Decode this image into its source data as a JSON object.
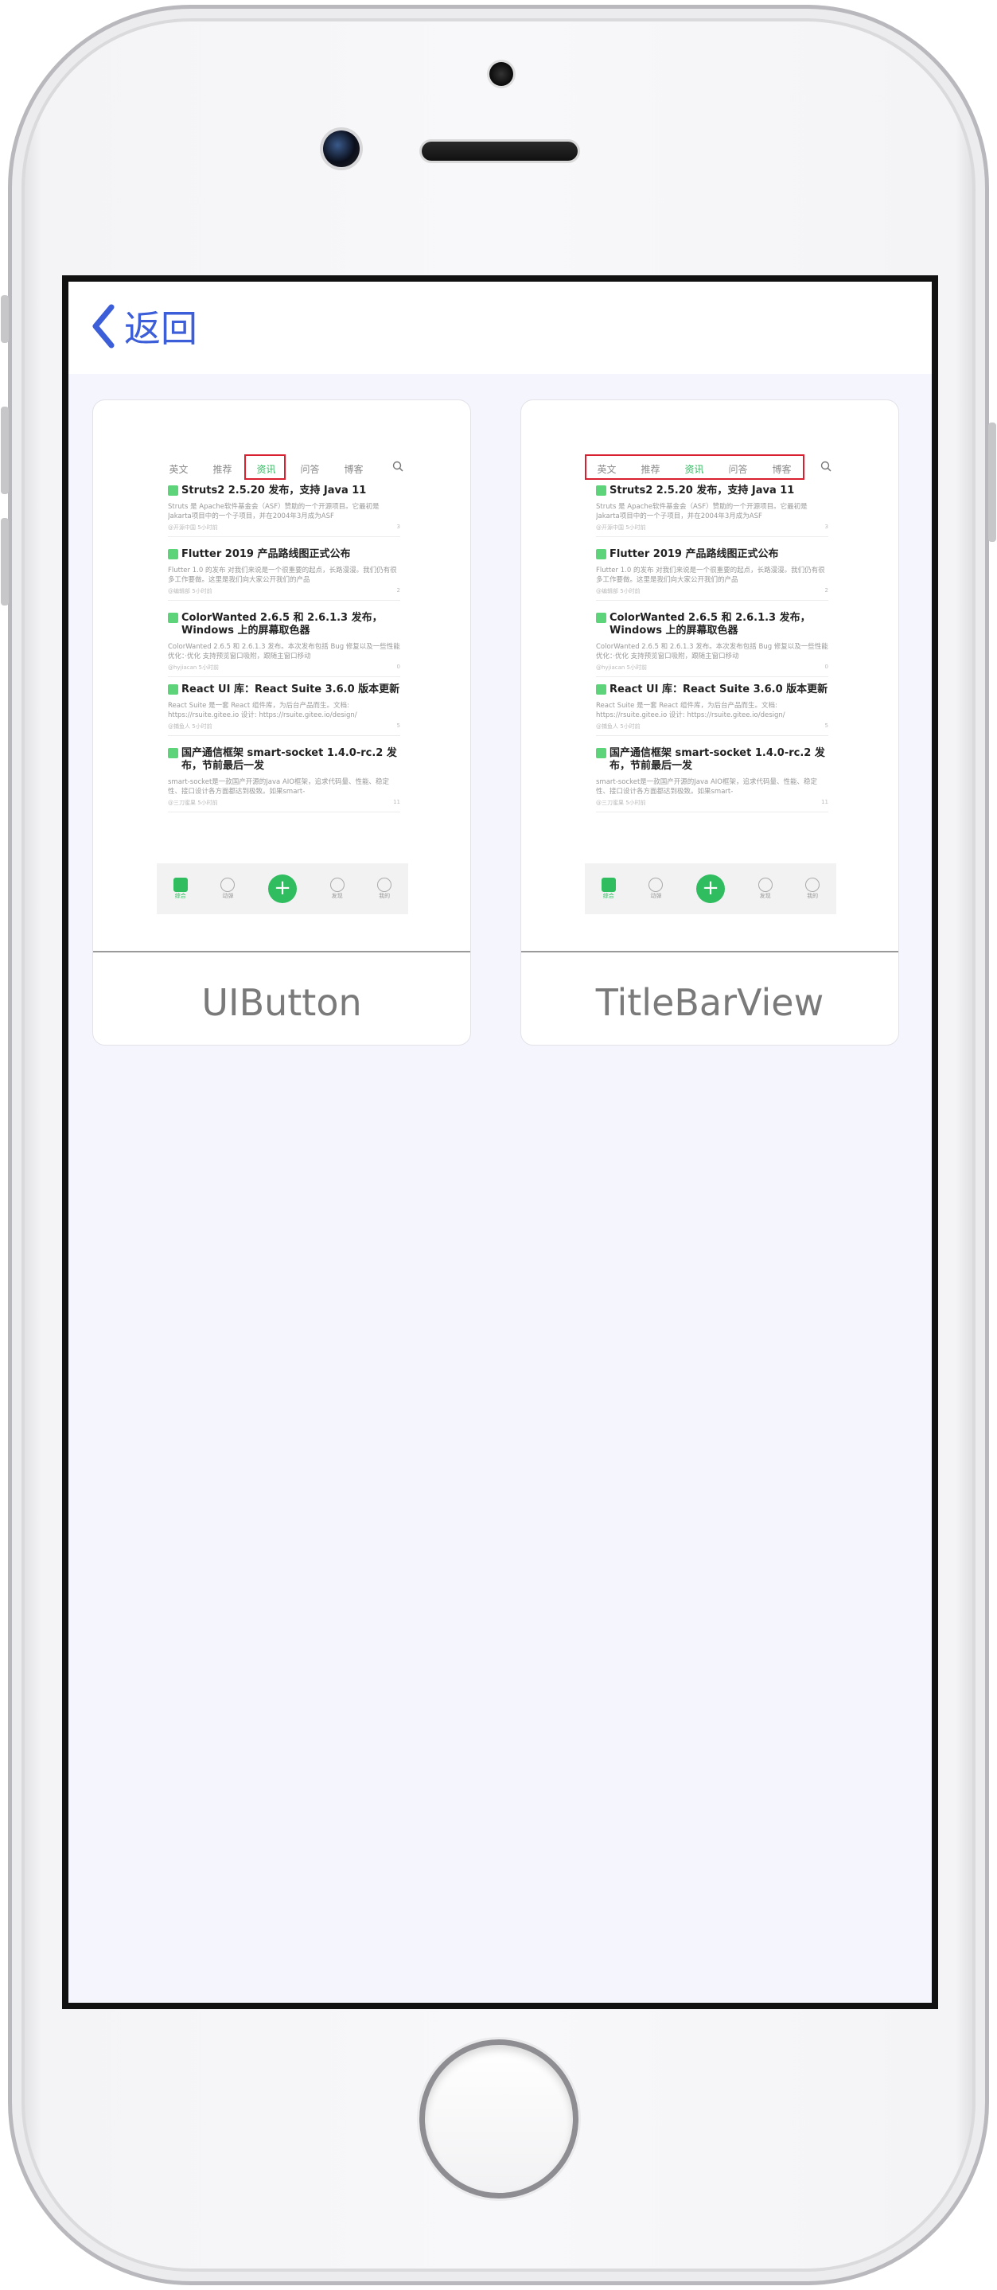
{
  "navbar": {
    "back_label": "返回"
  },
  "cards": [
    {
      "caption": "UIButton",
      "thumbnail": {
        "tabs": [
          "英文",
          "推荐",
          "资讯",
          "问答",
          "博客"
        ],
        "active_tab": 2,
        "news": [
          {
            "title": "Struts2 2.5.20 发布，支持 Java 11",
            "desc": "Struts 是 Apache软件基金会（ASF）赞助的一个开源项目。它最初是 Jakarta项目中的一个子项目，并在2004年3月成为ASF",
            "meta": "@开源中国 5小时前",
            "count": "3"
          },
          {
            "title": "Flutter 2019 产品路线图正式公布",
            "desc": "Flutter 1.0 的发布 对我们来说是一个很重要的起点，长路漫漫。我们仍有很多工作要做。这里是我们向大家公开我们的产品",
            "meta": "@编辑部 5小时前",
            "count": "2"
          },
          {
            "title": "ColorWanted 2.6.5 和 2.6.1.3 发布，Windows 上的屏幕取色器",
            "desc": "ColorWanted 2.6.5 和 2.6.1.3 发布。本次发布包括 Bug 修复以及一些性能优化：·优化 支持预览窗口吸附，跟随主窗口移动",
            "meta": "@hyjiacan 5小时前",
            "count": "0"
          },
          {
            "title": "React UI 库：React Suite 3.6.0 版本更新",
            "desc": "React Suite 是一套 React 组件库，为后台产品而生。文档: https://rsuite.gitee.io 设计: https://rsuite.gitee.io/design/",
            "meta": "@捕鱼人 5小时前",
            "count": "5"
          },
          {
            "title": "国产通信框架 smart-socket 1.4.0-rc.2 发布，节前最后一发",
            "desc": "smart-socket是一款国产开源的Java AIO框架，追求代码量、性能、稳定性、接口设计各方面都达到极致。如果smart-",
            "meta": "@三刀蜜果 5小时前",
            "count": "11"
          }
        ],
        "tabbar": [
          "综合",
          "动弹",
          "+",
          "发现",
          "我的"
        ]
      }
    },
    {
      "caption": "TitleBarView",
      "thumbnail": {
        "tabs": [
          "英文",
          "推荐",
          "资讯",
          "问答",
          "博客"
        ],
        "active_tab": 2,
        "news": [
          {
            "title": "Struts2 2.5.20 发布，支持 Java 11",
            "desc": "Struts 是 Apache软件基金会（ASF）赞助的一个开源项目。它最初是 Jakarta项目中的一个子项目，并在2004年3月成为ASF",
            "meta": "@开源中国 5小时前",
            "count": "3"
          },
          {
            "title": "Flutter 2019 产品路线图正式公布",
            "desc": "Flutter 1.0 的发布 对我们来说是一个很重要的起点，长路漫漫。我们仍有很多工作要做。这里是我们向大家公开我们的产品",
            "meta": "@编辑部 5小时前",
            "count": "2"
          },
          {
            "title": "ColorWanted 2.6.5 和 2.6.1.3 发布，Windows 上的屏幕取色器",
            "desc": "ColorWanted 2.6.5 和 2.6.1.3 发布。本次发布包括 Bug 修复以及一些性能优化：·优化 支持预览窗口吸附，跟随主窗口移动",
            "meta": "@hyjiacan 5小时前",
            "count": "0"
          },
          {
            "title": "React UI 库：React Suite 3.6.0 版本更新",
            "desc": "React Suite 是一套 React 组件库，为后台产品而生。文档: https://rsuite.gitee.io 设计: https://rsuite.gitee.io/design/",
            "meta": "@捕鱼人 5小时前",
            "count": "5"
          },
          {
            "title": "国产通信框架 smart-socket 1.4.0-rc.2 发布，节前最后一发",
            "desc": "smart-socket是一款国产开源的Java AIO框架，追求代码量、性能、稳定性、接口设计各方面都达到极致。如果smart-",
            "meta": "@三刀蜜果 5小时前",
            "count": "11"
          }
        ],
        "tabbar": [
          "综合",
          "动弹",
          "+",
          "发现",
          "我的"
        ]
      }
    }
  ],
  "colors": {
    "accent": "#3c5ed8",
    "green": "#2fbd5f",
    "highlight": "#d82030",
    "background": "#f5f6fd"
  },
  "icons": {
    "back": "chevron-left-icon",
    "search": "search-icon",
    "add": "plus-icon"
  }
}
